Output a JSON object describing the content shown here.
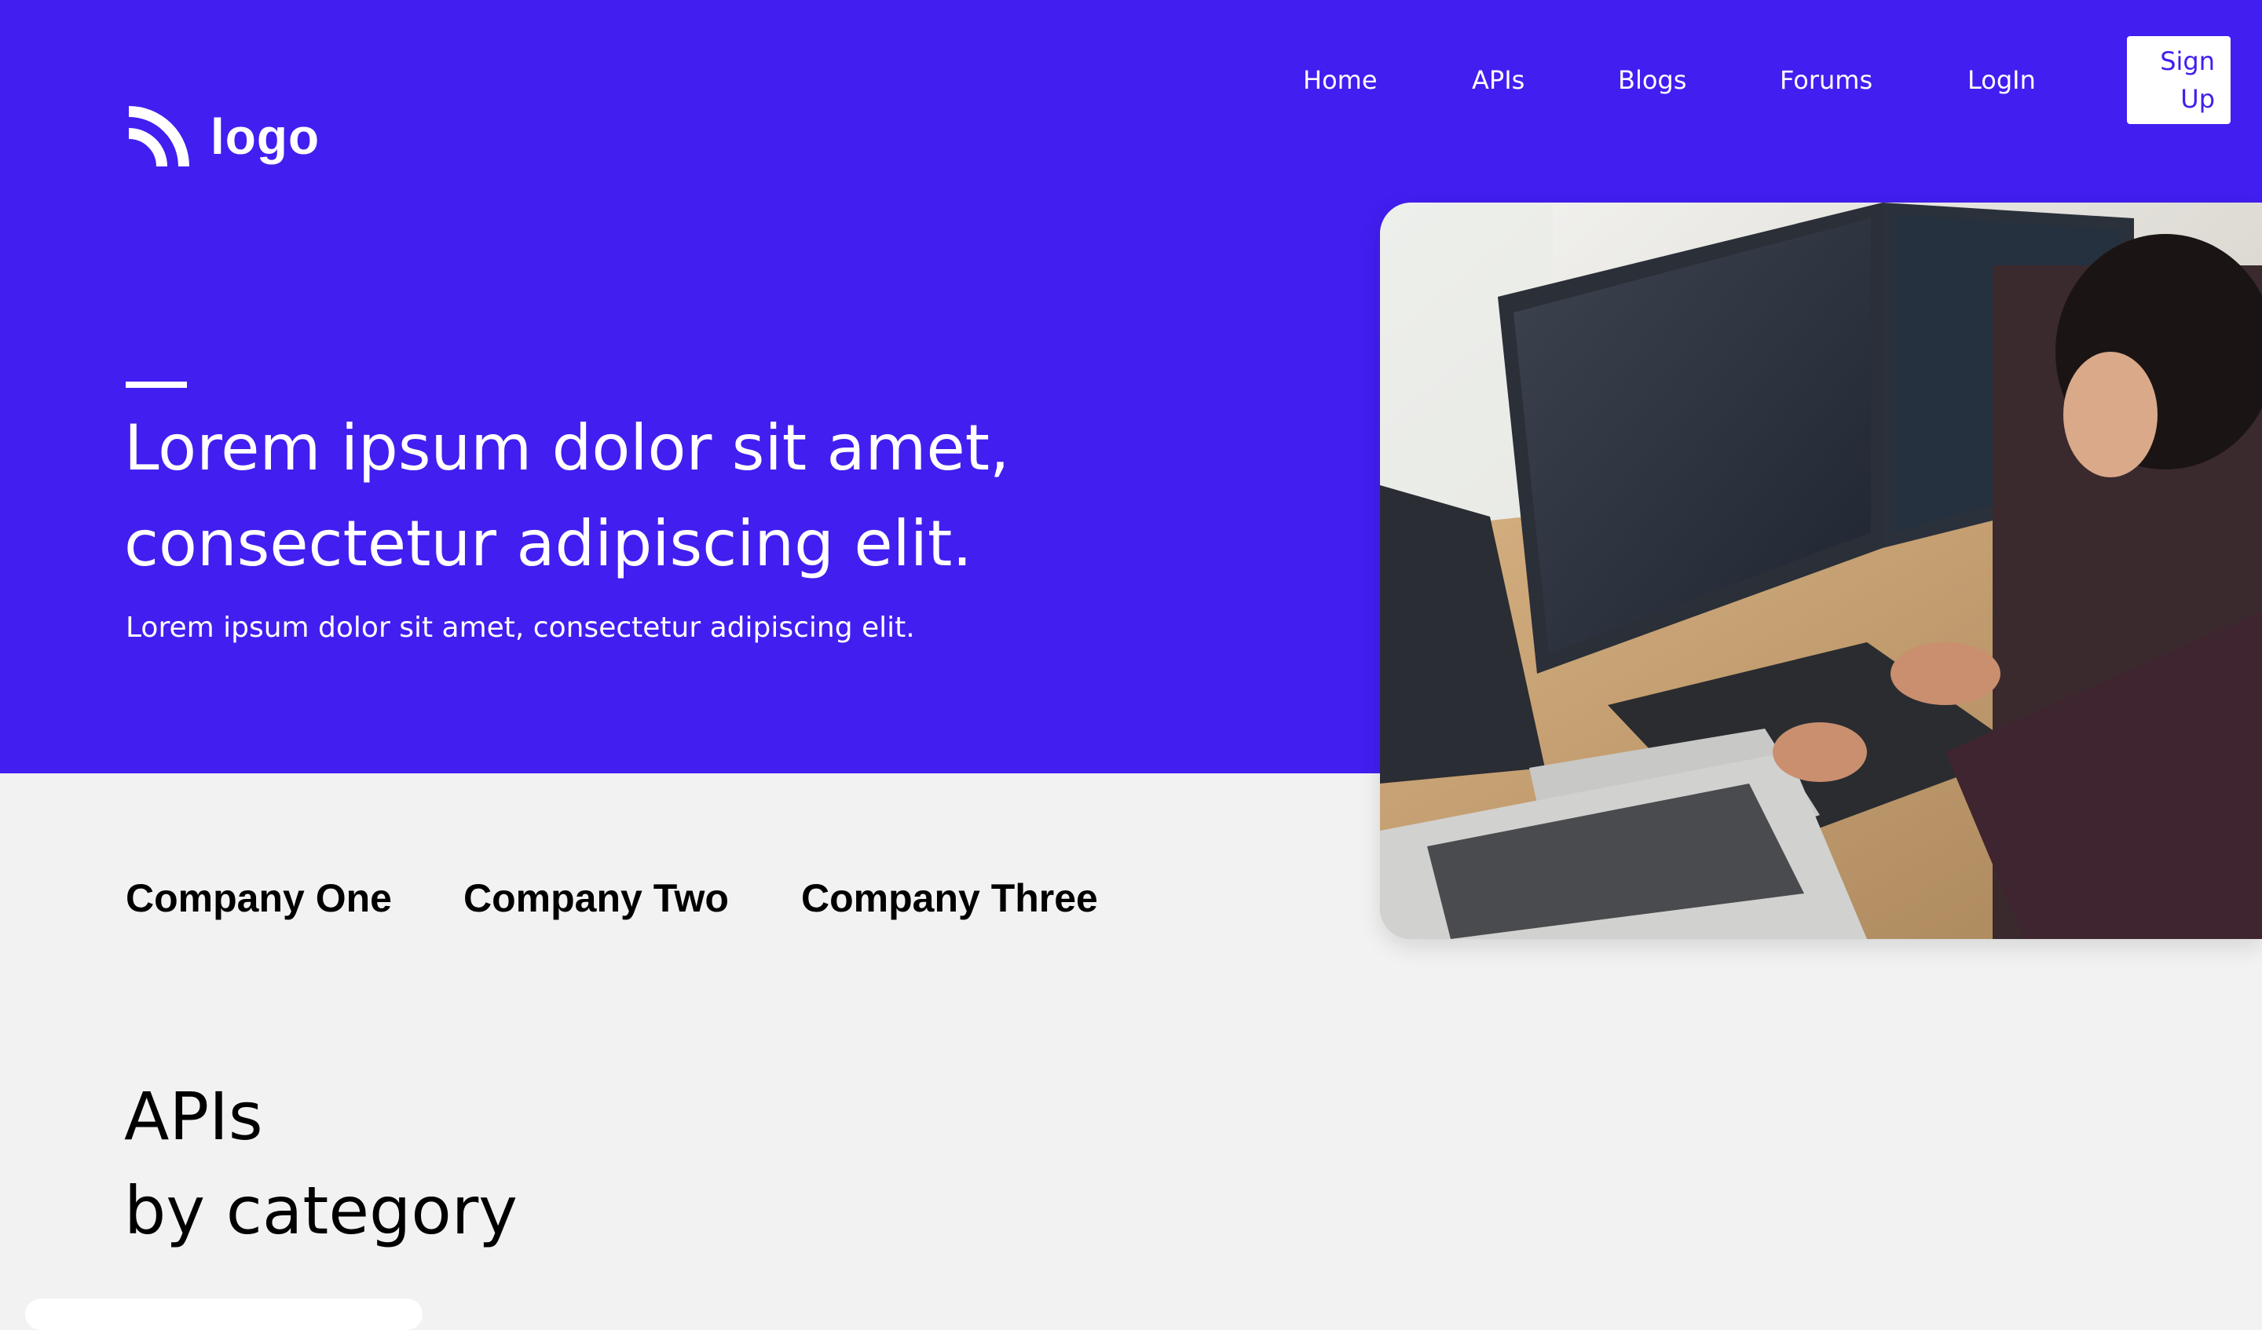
{
  "brand": {
    "logo_text": "logo",
    "primary_color": "#421ef0",
    "background_color": "#f2f2f2"
  },
  "nav": {
    "links": [
      {
        "label": "Home"
      },
      {
        "label": "APIs"
      },
      {
        "label": "Blogs"
      },
      {
        "label": "Forums"
      },
      {
        "label": "LogIn"
      }
    ],
    "signup_label_line1": "Sign",
    "signup_label_line2": "Up"
  },
  "hero": {
    "headline_line1": "Lorem ipsum dolor sit amet,",
    "headline_line2": "consectetur adipiscing elit.",
    "subtext": "Lorem ipsum dolor sit amet, consectetur adipiscing elit."
  },
  "companies": [
    "Company One",
    "Company Two",
    "Company Three"
  ],
  "section": {
    "title_line1": "APIs",
    "title_line2": "by category"
  }
}
